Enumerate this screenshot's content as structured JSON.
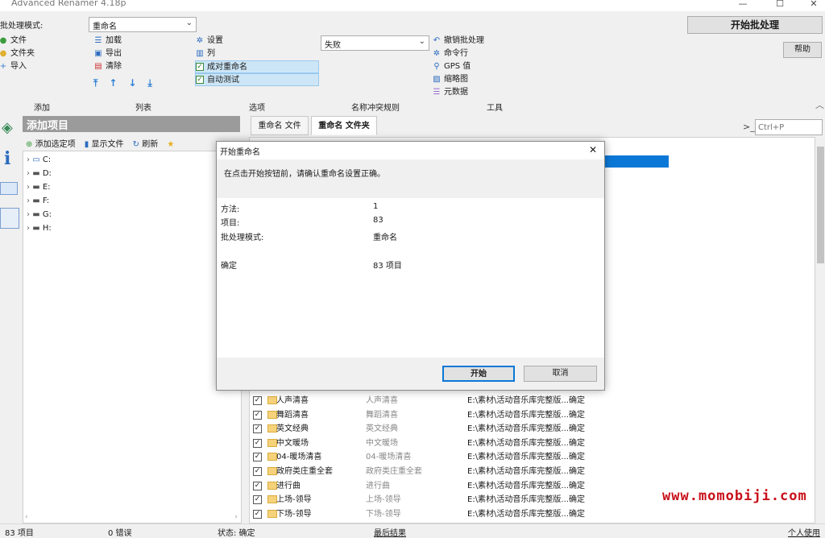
{
  "window": {
    "title": "Advanced Renamer 4.18p",
    "min": "—",
    "max": "☐",
    "close": "✕"
  },
  "ribbon": {
    "batch_mode_label": "批处理模式:",
    "batch_mode_value": "重命名",
    "start_batch": "开始批处理",
    "help": "帮助",
    "add_group": [
      "文件",
      "文件夹",
      "导入"
    ],
    "list_group": [
      "加载",
      "导出",
      "清除"
    ],
    "options_group": {
      "settings": "设置",
      "columns": "列",
      "rename_ok": "成对重命名",
      "auto_test": "自动测试"
    },
    "conflict_value": "失败",
    "tools_group": [
      "撤销批处理",
      "命令行",
      "GPS 值",
      "缩略图",
      "元数据"
    ],
    "sections": [
      "添加",
      "列表",
      "选项",
      "名称冲突规则",
      "工具"
    ],
    "command_placeholder": "Ctrl+P"
  },
  "left_panel": {
    "title": "添加项目",
    "add_selected": "添加选定项",
    "show_files": "显示文件",
    "refresh": "刷新",
    "drives": [
      "C:",
      "D:",
      "E:",
      "F:",
      "G:",
      "H:"
    ]
  },
  "tabs": {
    "rename_files": "重命名 文件",
    "rename_folders": "重命名 文件夹"
  },
  "grid": {
    "rows": [
      {
        "name": "人声清喜",
        "new": "人声清喜",
        "path": "E:\\素材\\活动音乐库完整版...",
        "status": "确定"
      },
      {
        "name": "舞蹈清喜",
        "new": "舞蹈清喜",
        "path": "E:\\素材\\活动音乐库完整版...",
        "status": "确定"
      },
      {
        "name": "英文经典",
        "new": "英文经典",
        "path": "E:\\素材\\活动音乐库完整版...",
        "status": "确定"
      },
      {
        "name": "中文暖场",
        "new": "中文暖场",
        "path": "E:\\素材\\活动音乐库完整版...",
        "status": "确定"
      },
      {
        "name": "04-暖场清喜",
        "new": "04-暖场清喜",
        "path": "E:\\素材\\活动音乐库完整版...",
        "status": "确定"
      },
      {
        "name": "政府类庄重全套",
        "new": "政府类庄重全套",
        "path": "E:\\素材\\活动音乐库完整版...",
        "status": "确定"
      },
      {
        "name": "进行曲",
        "new": "进行曲",
        "path": "E:\\素材\\活动音乐库完整版...",
        "status": "确定"
      },
      {
        "name": "上场-领导",
        "new": "上场-领导",
        "path": "E:\\素材\\活动音乐库完整版...",
        "status": "确定"
      },
      {
        "name": "下场-领导",
        "new": "下场-领导",
        "path": "E:\\素材\\活动音乐库完整版...",
        "status": "确定"
      }
    ]
  },
  "dialog": {
    "title": "开始重命名",
    "message": "在点击开始按钮前，请确认重命名设置正确。",
    "method_label": "方法:",
    "method_value": "1",
    "items_label": "项目:",
    "items_value": "83",
    "mode_label": "批处理模式:",
    "mode_value": "重命名",
    "confirm_label": "确定",
    "confirm_value": "83 项目",
    "start": "开始",
    "cancel": "取消"
  },
  "status": {
    "items": "83 项目",
    "errors": "0 错误",
    "state": "状态: 确定",
    "last_result": "最后结果",
    "license": "个人使用"
  },
  "watermark": "www.momobiji.com"
}
